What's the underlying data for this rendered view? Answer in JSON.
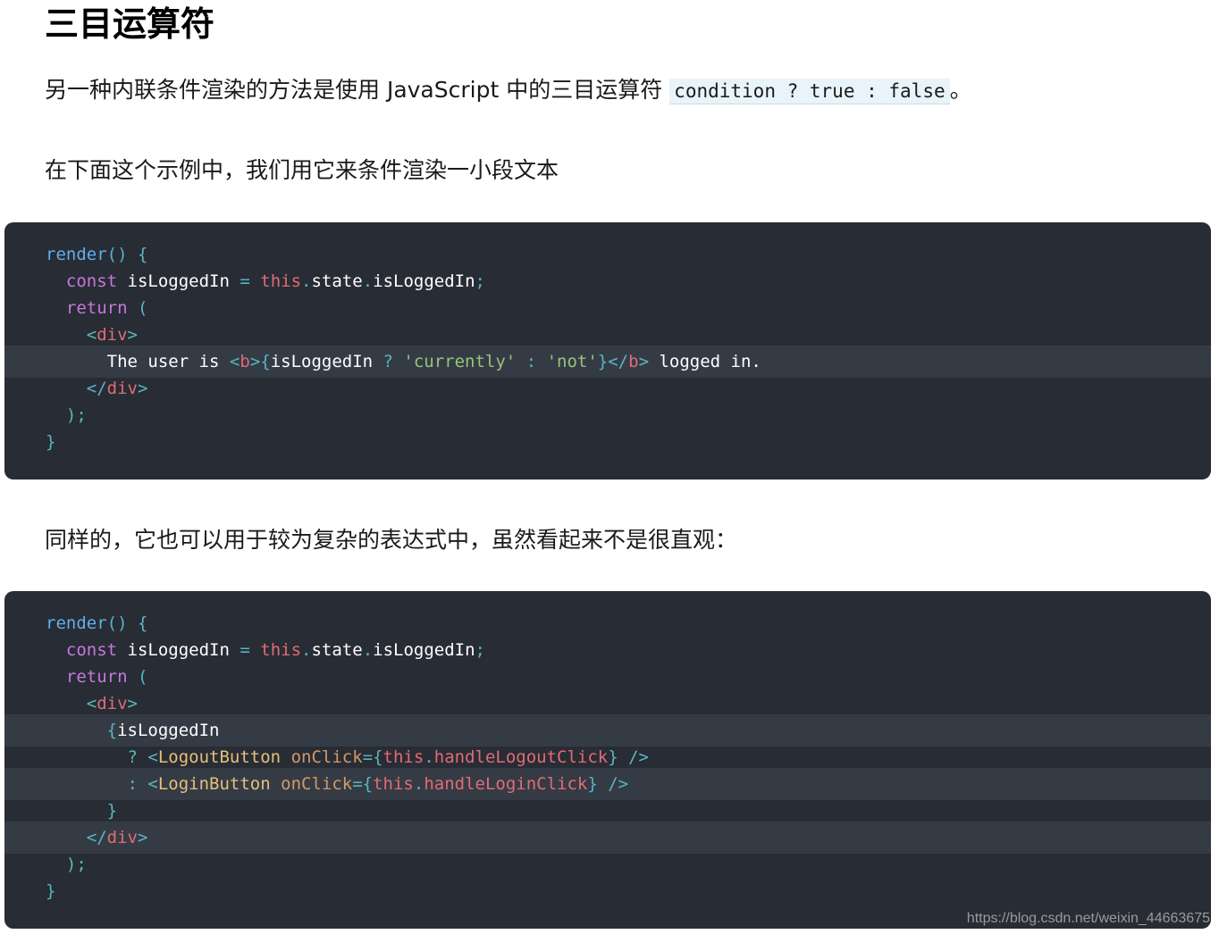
{
  "heading": "三目运算符",
  "para1": {
    "text_before": "另一种内联条件渲染的方法是使用 JavaScript 中的三目运算符 ",
    "code": "condition ? true : false",
    "text_after": "。"
  },
  "para2": "在下面这个示例中，我们用它来条件渲染一小段文本",
  "para3": "同样的，它也可以用于较为复杂的表达式中，虽然看起来不是很直观：",
  "code_block_1": {
    "lines": [
      [
        [
          "fn",
          "render"
        ],
        [
          "pn",
          "() {"
        ]
      ],
      [
        [
          "pn",
          "  "
        ],
        [
          "kw",
          "const"
        ],
        [
          "pn",
          " "
        ],
        [
          "id",
          "isLoggedIn"
        ],
        [
          "pn",
          " = "
        ],
        [
          "th",
          "this"
        ],
        [
          "pn",
          "."
        ],
        [
          "id",
          "state"
        ],
        [
          "pn",
          "."
        ],
        [
          "id",
          "isLoggedIn"
        ],
        [
          "pn",
          ";"
        ]
      ],
      [
        [
          "pn",
          "  "
        ],
        [
          "kw",
          "return"
        ],
        [
          "pn",
          " ("
        ]
      ],
      [
        [
          "pn",
          "    <"
        ],
        [
          "tg",
          "div"
        ],
        [
          "pn",
          ">"
        ]
      ],
      [
        [
          "tx",
          "      The user is "
        ],
        [
          "pn",
          "<"
        ],
        [
          "tg",
          "b"
        ],
        [
          "pn",
          ">{"
        ],
        [
          "id",
          "isLoggedIn"
        ],
        [
          "pn",
          " ? "
        ],
        [
          "st",
          "'currently'"
        ],
        [
          "pn",
          " : "
        ],
        [
          "st",
          "'not'"
        ],
        [
          "pn",
          "}</"
        ],
        [
          "tg",
          "b"
        ],
        [
          "pn",
          "> "
        ],
        [
          "tx",
          "logged in."
        ]
      ],
      [
        [
          "pn",
          "    </"
        ],
        [
          "tg",
          "div"
        ],
        [
          "pn",
          ">"
        ]
      ],
      [
        [
          "pn",
          "  );"
        ]
      ],
      [
        [
          "pn",
          "}"
        ]
      ]
    ],
    "highlighted": [
      4
    ]
  },
  "code_block_2": {
    "lines": [
      [
        [
          "fn",
          "render"
        ],
        [
          "pn",
          "() {"
        ]
      ],
      [
        [
          "pn",
          "  "
        ],
        [
          "kw",
          "const"
        ],
        [
          "pn",
          " "
        ],
        [
          "id",
          "isLoggedIn"
        ],
        [
          "pn",
          " = "
        ],
        [
          "th",
          "this"
        ],
        [
          "pn",
          "."
        ],
        [
          "id",
          "state"
        ],
        [
          "pn",
          "."
        ],
        [
          "id",
          "isLoggedIn"
        ],
        [
          "pn",
          ";"
        ]
      ],
      [
        [
          "pn",
          "  "
        ],
        [
          "kw",
          "return"
        ],
        [
          "pn",
          " ("
        ]
      ],
      [
        [
          "pn",
          "    <"
        ],
        [
          "tg",
          "div"
        ],
        [
          "pn",
          ">"
        ]
      ],
      [
        [
          "pn",
          "      {"
        ],
        [
          "id",
          "isLoggedIn"
        ]
      ],
      [
        [
          "pn",
          "        ? <"
        ],
        [
          "cp",
          "LogoutButton"
        ],
        [
          "pn",
          " "
        ],
        [
          "at",
          "onClick"
        ],
        [
          "pn",
          "={"
        ],
        [
          "th",
          "this"
        ],
        [
          "pn",
          "."
        ],
        [
          "th",
          "handleLogoutClick"
        ],
        [
          "pn",
          "} />"
        ]
      ],
      [
        [
          "pn",
          "        : <"
        ],
        [
          "cp",
          "LoginButton"
        ],
        [
          "pn",
          " "
        ],
        [
          "at",
          "onClick"
        ],
        [
          "pn",
          "={"
        ],
        [
          "th",
          "this"
        ],
        [
          "pn",
          "."
        ],
        [
          "th",
          "handleLoginClick"
        ],
        [
          "pn",
          "} />"
        ]
      ],
      [
        [
          "pn",
          "      }"
        ]
      ],
      [
        [
          "pn",
          "    </"
        ],
        [
          "tg",
          "div"
        ],
        [
          "pn",
          ">"
        ]
      ],
      [
        [
          "pn",
          "  );"
        ]
      ],
      [
        [
          "pn",
          "}"
        ]
      ]
    ],
    "highlighted": [
      4,
      6,
      8
    ]
  },
  "watermark": "https://blog.csdn.net/weixin_44663675"
}
